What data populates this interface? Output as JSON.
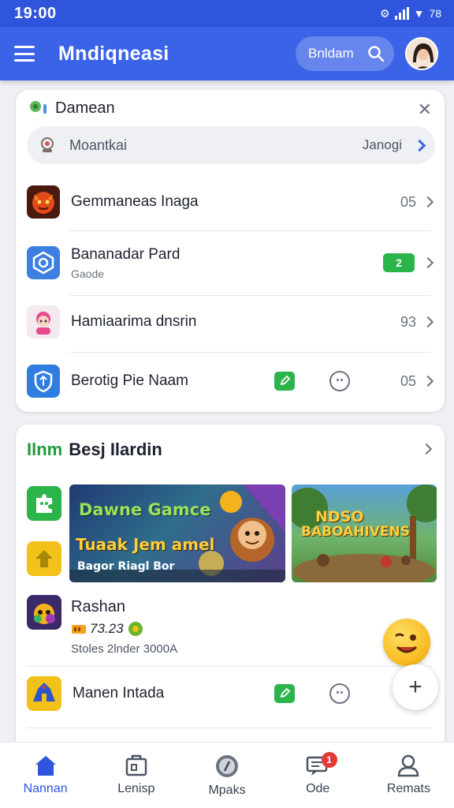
{
  "status_bar": {
    "time": "19:00",
    "battery": "78"
  },
  "app_bar": {
    "title": "Mndiqneasi",
    "search_label": "Bnldam"
  },
  "featured_card": {
    "title": "Damean",
    "filter_row": {
      "label": "Moantkai",
      "value": "Janogi"
    },
    "items": [
      {
        "name": "Gemmaneas Inaga",
        "value": "05"
      },
      {
        "name": "Bananadar Pard",
        "subtitle": "Gaode",
        "badge": "2"
      },
      {
        "name": "Hamiaarima dnsrin",
        "value": "93"
      },
      {
        "name": "Berotig Pie Naam",
        "value": "05"
      }
    ]
  },
  "games_card": {
    "title_accent": "Ilnm",
    "title_rest": "Besj Ilardin",
    "banners": [
      {
        "line1": "Dawne Gamce",
        "line2": "Tuaak Jem amel",
        "line3": "Bagor Riagl Bor"
      },
      {
        "line1": "NDSO",
        "line2": "BABOAHIVENS"
      }
    ],
    "game": {
      "name": "Rashan",
      "rating": "73.23",
      "subtitle": "Stoles 2lnder 3000A"
    },
    "list_item": {
      "name": "Manen Intada"
    }
  },
  "bottom_nav": [
    {
      "label": "Nannan",
      "icon": "home-icon"
    },
    {
      "label": "Lenisp",
      "icon": "library-icon"
    },
    {
      "label": "Mpaks",
      "icon": "compass-icon"
    },
    {
      "label": "Ode",
      "icon": "inbox-icon",
      "badge": "1"
    },
    {
      "label": "Remats",
      "icon": "profile-icon"
    }
  ],
  "colors": {
    "primary": "#3b63e8",
    "status_bar": "#2f55dd",
    "accent_green": "#2bb44a",
    "badge_red": "#e53935"
  }
}
